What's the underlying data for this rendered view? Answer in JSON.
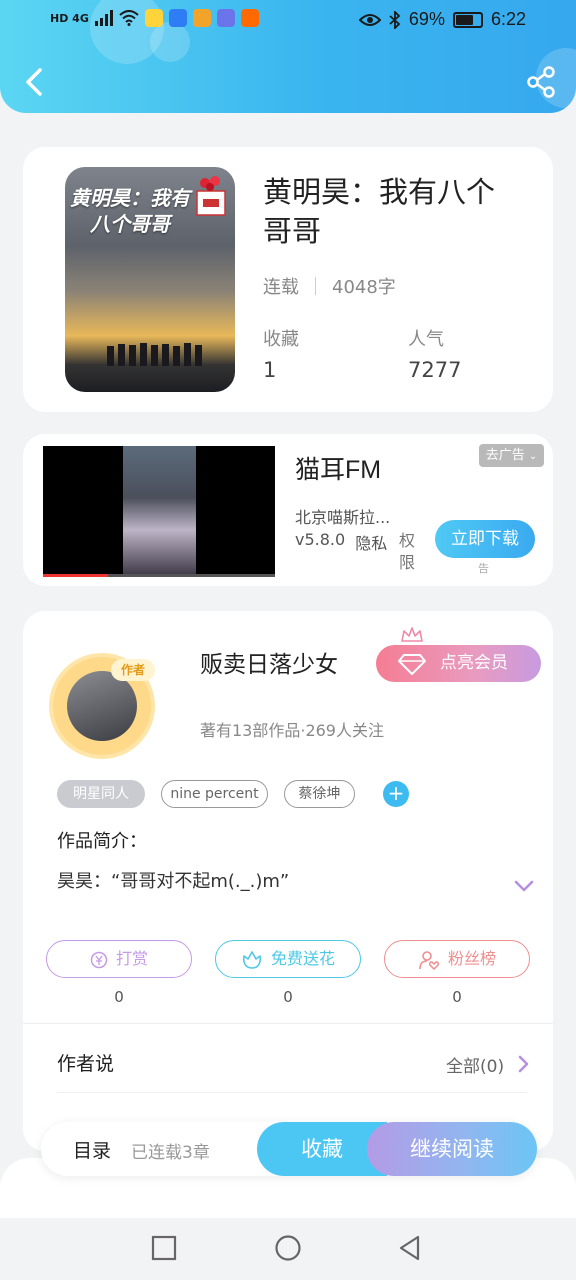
{
  "status_bar": {
    "network": "HD 4G",
    "battery_percent": "69%",
    "battery_level": 0.69,
    "time": "6:22"
  },
  "header": {
    "back_icon": "chevron-left-icon",
    "share_icon": "share-icon"
  },
  "book": {
    "title": "黄明昊：我有八个哥哥",
    "cover_text": "黄明昊：我有八个哥哥",
    "status": "连载",
    "word_count": "4048字",
    "collect_label": "收藏",
    "collect_value": "1",
    "popularity_label": "人气",
    "popularity_value": "7277"
  },
  "ad": {
    "title": "猫耳FM",
    "badge": "去广告",
    "company": "北京喵斯拉...",
    "version": "v5.8.0",
    "privacy": "隐私",
    "permission": "权限",
    "download": "立即下载",
    "note": "告"
  },
  "author": {
    "badge": "作者",
    "name": "贩卖日落少女",
    "vip_button": "点亮会员",
    "stats": "著有13部作品·269人关注",
    "tags": [
      "明星同人",
      "nine percent",
      "蔡徐坤"
    ],
    "add_tag": "+",
    "intro_label": "作品简介：",
    "intro_text": "昊昊：“哥哥对不起m(._.)m”"
  },
  "actions": [
    {
      "label": "打赏",
      "count": "0",
      "color": "#c59be6"
    },
    {
      "label": "免费送花",
      "count": "0",
      "color": "#4fc9e6"
    },
    {
      "label": "粉丝榜",
      "count": "0",
      "color": "#ef8f8f"
    }
  ],
  "author_say": {
    "label": "作者说",
    "all": "全部(0)"
  },
  "bottom_bar": {
    "toc_label": "目录",
    "toc_count": "已连载3章",
    "collect": "收藏",
    "continue_reading": "继续阅读"
  },
  "nav": [
    "recent-apps-icon",
    "home-icon",
    "back-icon"
  ]
}
